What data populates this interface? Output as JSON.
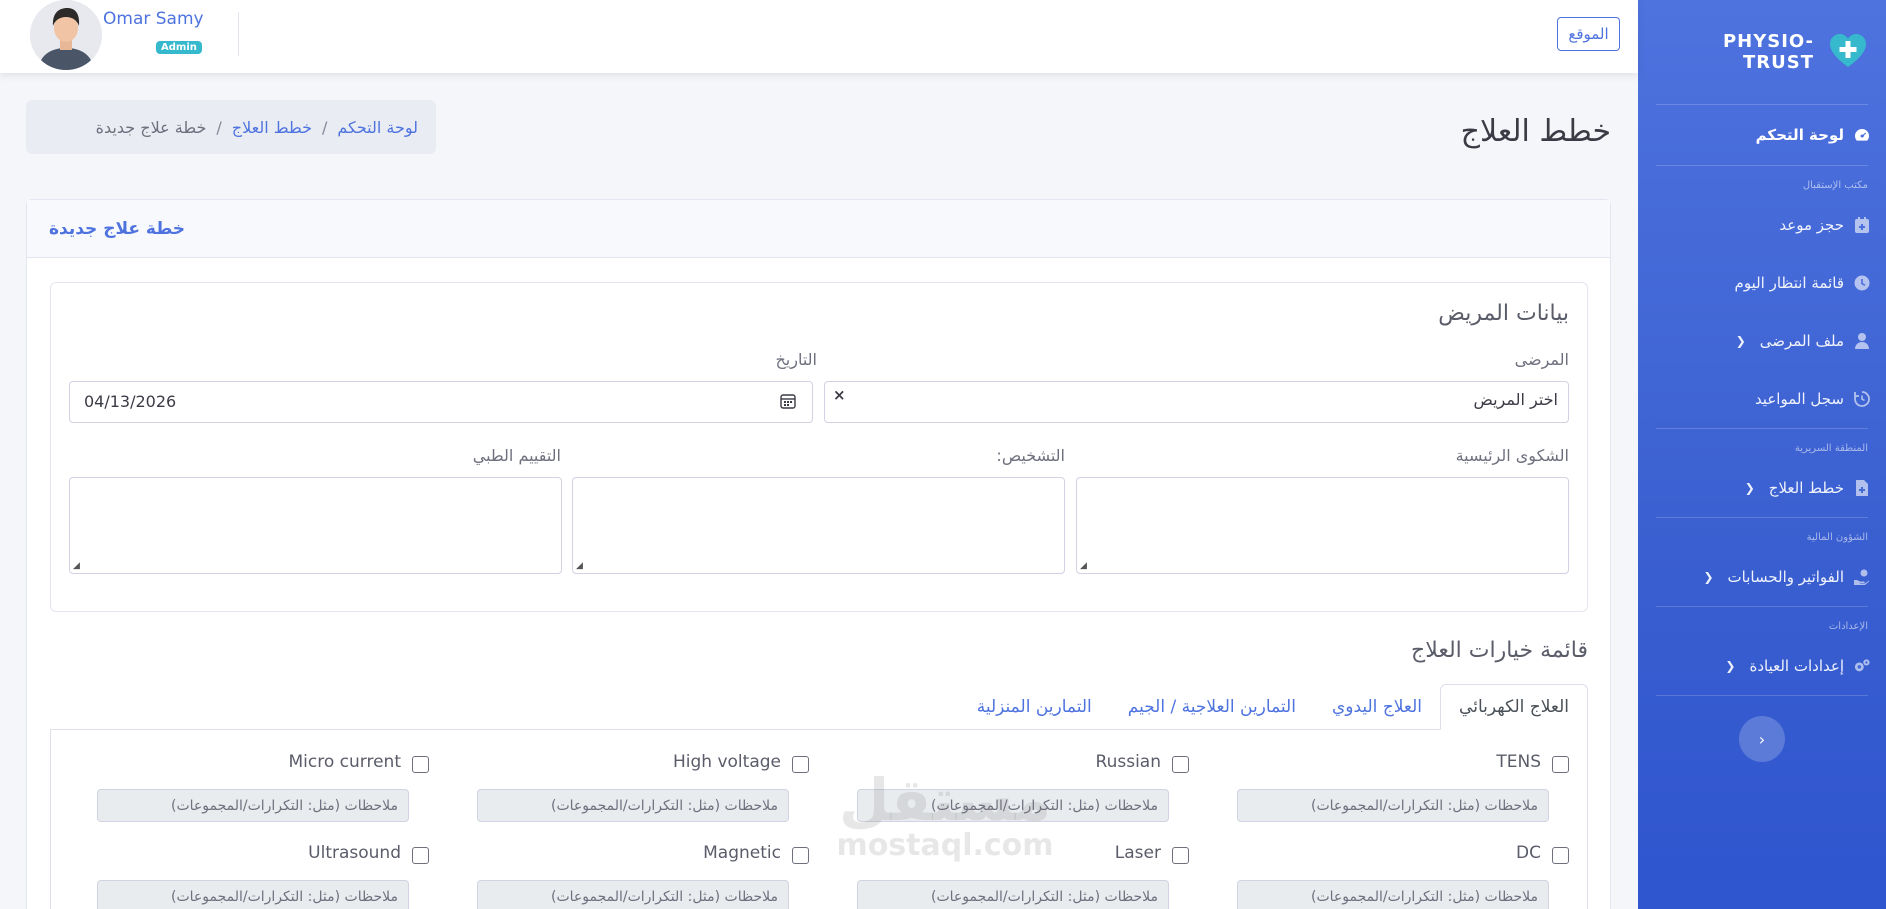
{
  "sidebar": {
    "brand": "PHYSIO-TRUST",
    "dashboard": "لوحة التحكم",
    "heading_reception": "مكتب الإستقبال",
    "book_appointment": "حجز موعد",
    "today_waitlist": "قائمة انتظار اليوم",
    "patient_file": "ملف المرضى",
    "appointment_log": "سجل المواعيد",
    "heading_clinical": "المنطقة السريرية",
    "treatment_plans": "خطط العلاج",
    "heading_finance": "الشؤون المالية",
    "invoices": "الفواتير والحسابات",
    "heading_settings": "الإعدادات",
    "clinic_settings": "إعدادات العيادة",
    "toggle": "‹"
  },
  "topbar": {
    "user_name": "Omar Samy",
    "user_role": "Admin",
    "site_button": "الموقع"
  },
  "page": {
    "title": "خطط العلاج",
    "breadcrumb": {
      "home": "لوحة التحكم",
      "section": "خطط العلاج",
      "current": "خطة علاج جديدة",
      "sep": "/"
    }
  },
  "card": {
    "header": "خطة علاج جديدة",
    "patient_section_title": "بيانات المريض",
    "patient_label": "المرضى",
    "patient_placeholder": "اختر المريض",
    "clear_symbol": "×",
    "date_label": "التاريخ",
    "date_value": "04/13/2026",
    "complaint_label": "الشكوى الرئيسية",
    "diagnosis_label": "التشخيص:",
    "assessment_label": "التقييم الطبي",
    "options_title": "قائمة خيارات العلاج",
    "tabs": [
      "العلاج الكهربائي",
      "العلاج اليدوي",
      "التمارين العلاجية / الجيم",
      "التمارين المنزلية"
    ],
    "note_placeholder": "ملاحظات (مثل: التكرارات/المجموعات)",
    "options": [
      "TENS",
      "Russian",
      "High voltage",
      "Micro current",
      "DC",
      "Laser",
      "Magnetic",
      "Ultrasound"
    ]
  },
  "watermark": {
    "line1": "مستقل",
    "line2": "mostaql.com"
  },
  "colors": {
    "primary": "#4e73df",
    "badge": "#36b9cc",
    "sidebar_bottom": "#2f55cf"
  }
}
